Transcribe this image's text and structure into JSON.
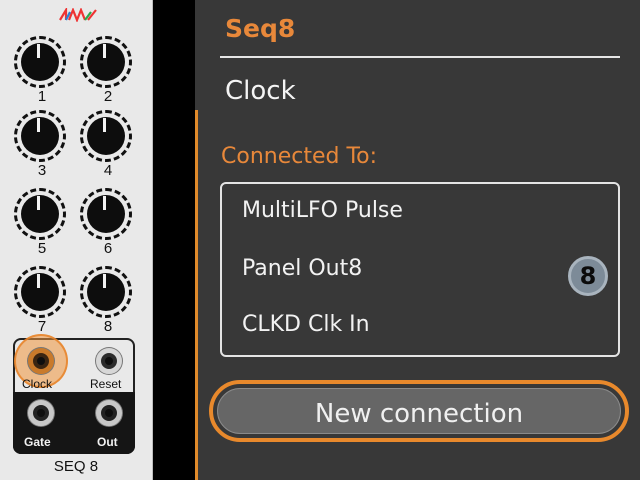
{
  "colors": {
    "accent": "#e8883a",
    "panel_bg": "#383838",
    "module_bg": "#e9e9e9"
  },
  "module": {
    "logo": "4ms-logo",
    "knobs": [
      "1",
      "2",
      "3",
      "4",
      "5",
      "6",
      "7",
      "8"
    ],
    "jacks": {
      "clock": "Clock",
      "reset": "Reset",
      "gate": "Gate",
      "out": "Out"
    },
    "name": "SEQ 8"
  },
  "popup": {
    "title": "Seq8",
    "jack_name": "Clock",
    "connected_label": "Connected To:",
    "connections": [
      "MultiLFO Pulse",
      "Panel Out8",
      "CLKD Clk In"
    ],
    "badge": "8",
    "new_connection_label": "New connection"
  }
}
